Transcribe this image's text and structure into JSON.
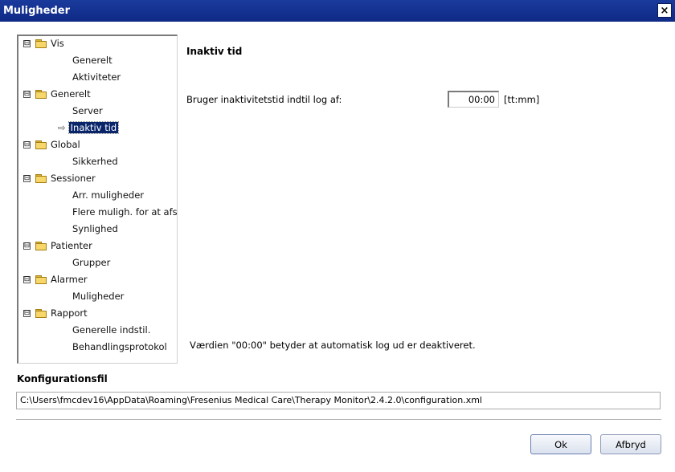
{
  "window": {
    "title": "Muligheder",
    "close_glyph": "×"
  },
  "tree": {
    "groups": [
      {
        "label": "Vis",
        "expander": "⊟",
        "children": [
          "Generelt",
          "Aktiviteter"
        ]
      },
      {
        "label": "Generelt",
        "expander": "⊟",
        "children": [
          "Server",
          "Inaktiv tid"
        ]
      },
      {
        "label": "Global",
        "expander": "⊟",
        "children": [
          "Sikkerhed"
        ]
      },
      {
        "label": "Sessioner",
        "expander": "⊟",
        "children": [
          "Arr. muligheder",
          "Flere muligh. for at afslutte",
          "Synlighed"
        ]
      },
      {
        "label": "Patienter",
        "expander": "⊟",
        "children": [
          "Grupper"
        ]
      },
      {
        "label": "Alarmer",
        "expander": "⊟",
        "children": [
          "Muligheder"
        ]
      },
      {
        "label": "Rapport",
        "expander": "⊟",
        "children": [
          "Generelle indstil.",
          "Behandlingsprotokol"
        ]
      }
    ],
    "selected": "Inaktiv tid",
    "selected_marker": "⇨"
  },
  "panel": {
    "title": "Inaktiv tid",
    "inactivity_label": "Bruger inaktivitetstid indtil log af:",
    "inactivity_value": "00:00",
    "inactivity_unit": "[tt:mm]",
    "note": "Værdien \"00:00\" betyder at automatisk log ud er deaktiveret."
  },
  "config": {
    "title": "Konfigurationsfil",
    "path": "C:\\Users\\fmcdev16\\AppData\\Roaming\\Fresenius Medical Care\\Therapy Monitor\\2.4.2.0\\configuration.xml"
  },
  "buttons": {
    "ok": "Ok",
    "cancel": "Afbryd"
  },
  "colors": {
    "titlebar": "#0f2a86",
    "folder": "#f7d66a",
    "selection": "#0a246a"
  }
}
